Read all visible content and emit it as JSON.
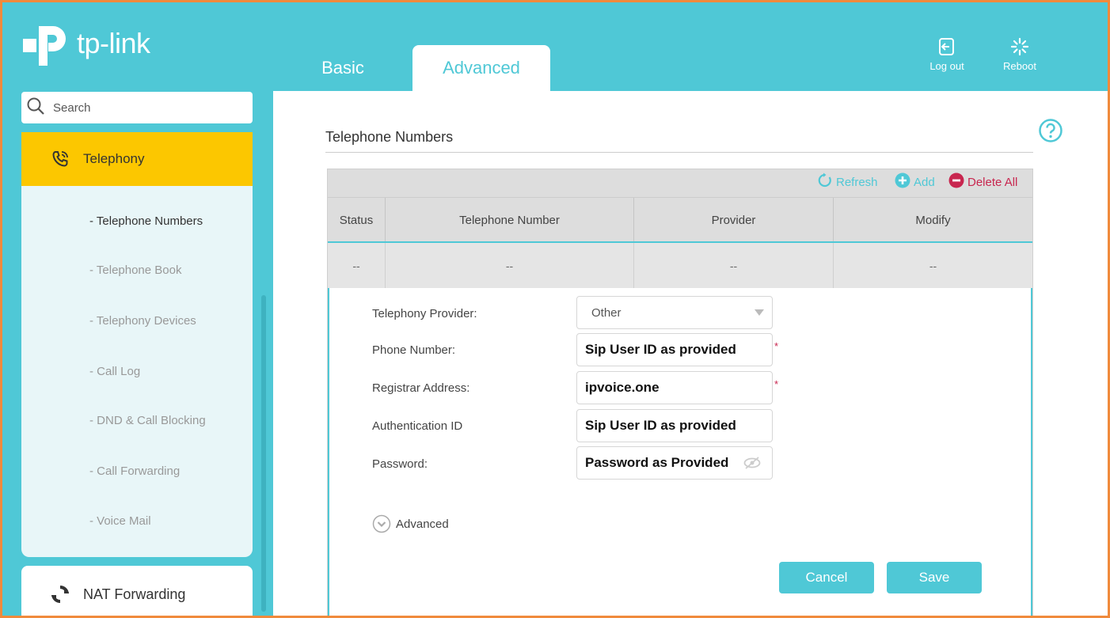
{
  "brand": {
    "name": "tp-link"
  },
  "tabs": [
    {
      "label": "Basic",
      "active": false
    },
    {
      "label": "Advanced",
      "active": true
    }
  ],
  "header_actions": {
    "logout": "Log out",
    "reboot": "Reboot"
  },
  "sidebar": {
    "search_placeholder": "Search",
    "active_section": "Telephony",
    "items": [
      {
        "label": "- Telephone Numbers",
        "active": true
      },
      {
        "label": "- Telephone Book",
        "active": false
      },
      {
        "label": "- Telephony Devices",
        "active": false
      },
      {
        "label": "- Call Log",
        "active": false
      },
      {
        "label": "- DND & Call Blocking",
        "active": false
      },
      {
        "label": "- Call Forwarding",
        "active": false
      },
      {
        "label": "- Voice Mail",
        "active": false
      }
    ],
    "next_section": "NAT Forwarding"
  },
  "main": {
    "title": "Telephone Numbers",
    "toolbar": {
      "refresh": "Refresh",
      "add": "Add",
      "delete_all": "Delete All"
    },
    "table": {
      "columns": [
        "Status",
        "Telephone Number",
        "Provider",
        "Modify"
      ],
      "row": [
        "--",
        "--",
        "--",
        "--"
      ]
    },
    "form": {
      "provider_label": "Telephony Provider:",
      "provider_value": "Other",
      "phone_label": "Phone Number:",
      "phone_value": "Sip User ID as provided",
      "registrar_label": "Registrar Address:",
      "registrar_value": "ipvoice.one",
      "auth_label": "Authentication ID",
      "auth_value": "Sip User ID as provided",
      "password_label": "Password:",
      "password_value": "Password as Provided",
      "required_mark": "*",
      "advanced_toggle": "Advanced",
      "cancel": "Cancel",
      "save": "Save"
    }
  },
  "colors": {
    "primary": "#4fc8d6",
    "active_menu": "#fcc700",
    "delete": "#c8264f",
    "frame_border": "#f08a3c"
  }
}
